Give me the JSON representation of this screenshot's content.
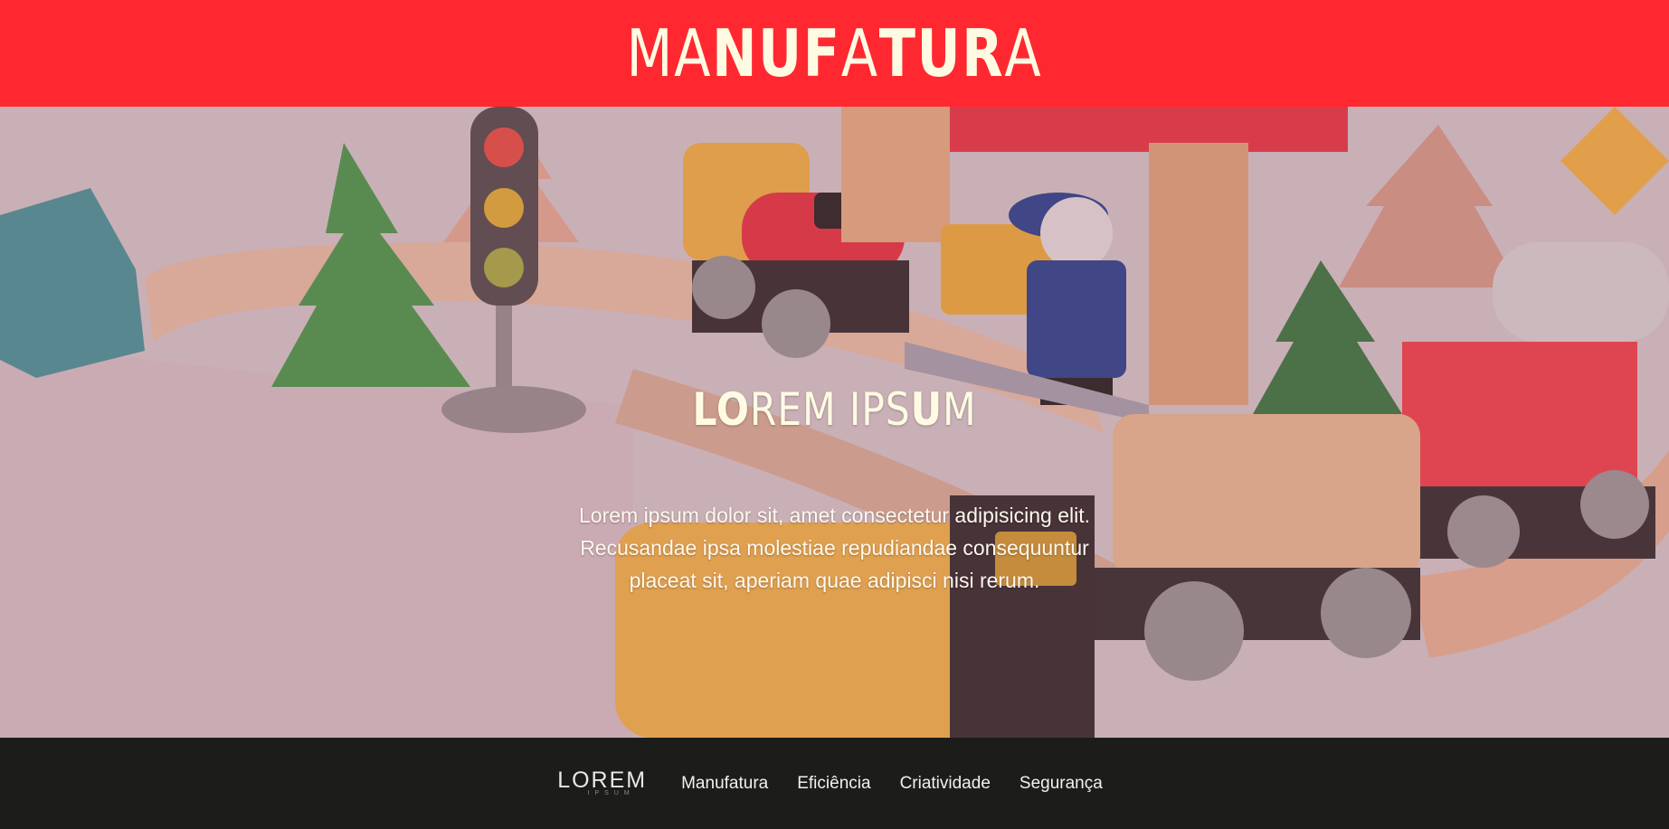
{
  "header": {
    "title_parts": [
      {
        "text": "M",
        "weight": "thin"
      },
      {
        "text": "A",
        "weight": "thin"
      },
      {
        "text": "N",
        "weight": "bold"
      },
      {
        "text": "U",
        "weight": "bold"
      },
      {
        "text": "F",
        "weight": "bold"
      },
      {
        "text": "A",
        "weight": "thin"
      },
      {
        "text": "T",
        "weight": "bold"
      },
      {
        "text": "U",
        "weight": "bold"
      },
      {
        "text": "R",
        "weight": "bold"
      },
      {
        "text": "A",
        "weight": "thin"
      }
    ],
    "background_color": "#ff2830",
    "text_color": "#fffbe3"
  },
  "hero": {
    "title_parts": [
      {
        "text": "LO",
        "weight": "bold"
      },
      {
        "text": "REM IPS",
        "weight": "thin"
      },
      {
        "text": "U",
        "weight": "bold"
      },
      {
        "text": "M",
        "weight": "thin"
      }
    ],
    "description": "Lorem ipsum dolor sit, amet consectetur adipisicing elit. Recusandae ipsa molestiae repudiandae consequuntur placeat sit, aperiam quae adipisci nisi rerum.",
    "background_image": "toy-train-scene"
  },
  "footer": {
    "logo_main": "LOREM",
    "logo_sub": "IPSUM",
    "nav": [
      {
        "label": "Manufatura"
      },
      {
        "label": "Eficiência"
      },
      {
        "label": "Criatividade"
      },
      {
        "label": "Segurança"
      }
    ],
    "background_color": "#1c1d1a"
  }
}
